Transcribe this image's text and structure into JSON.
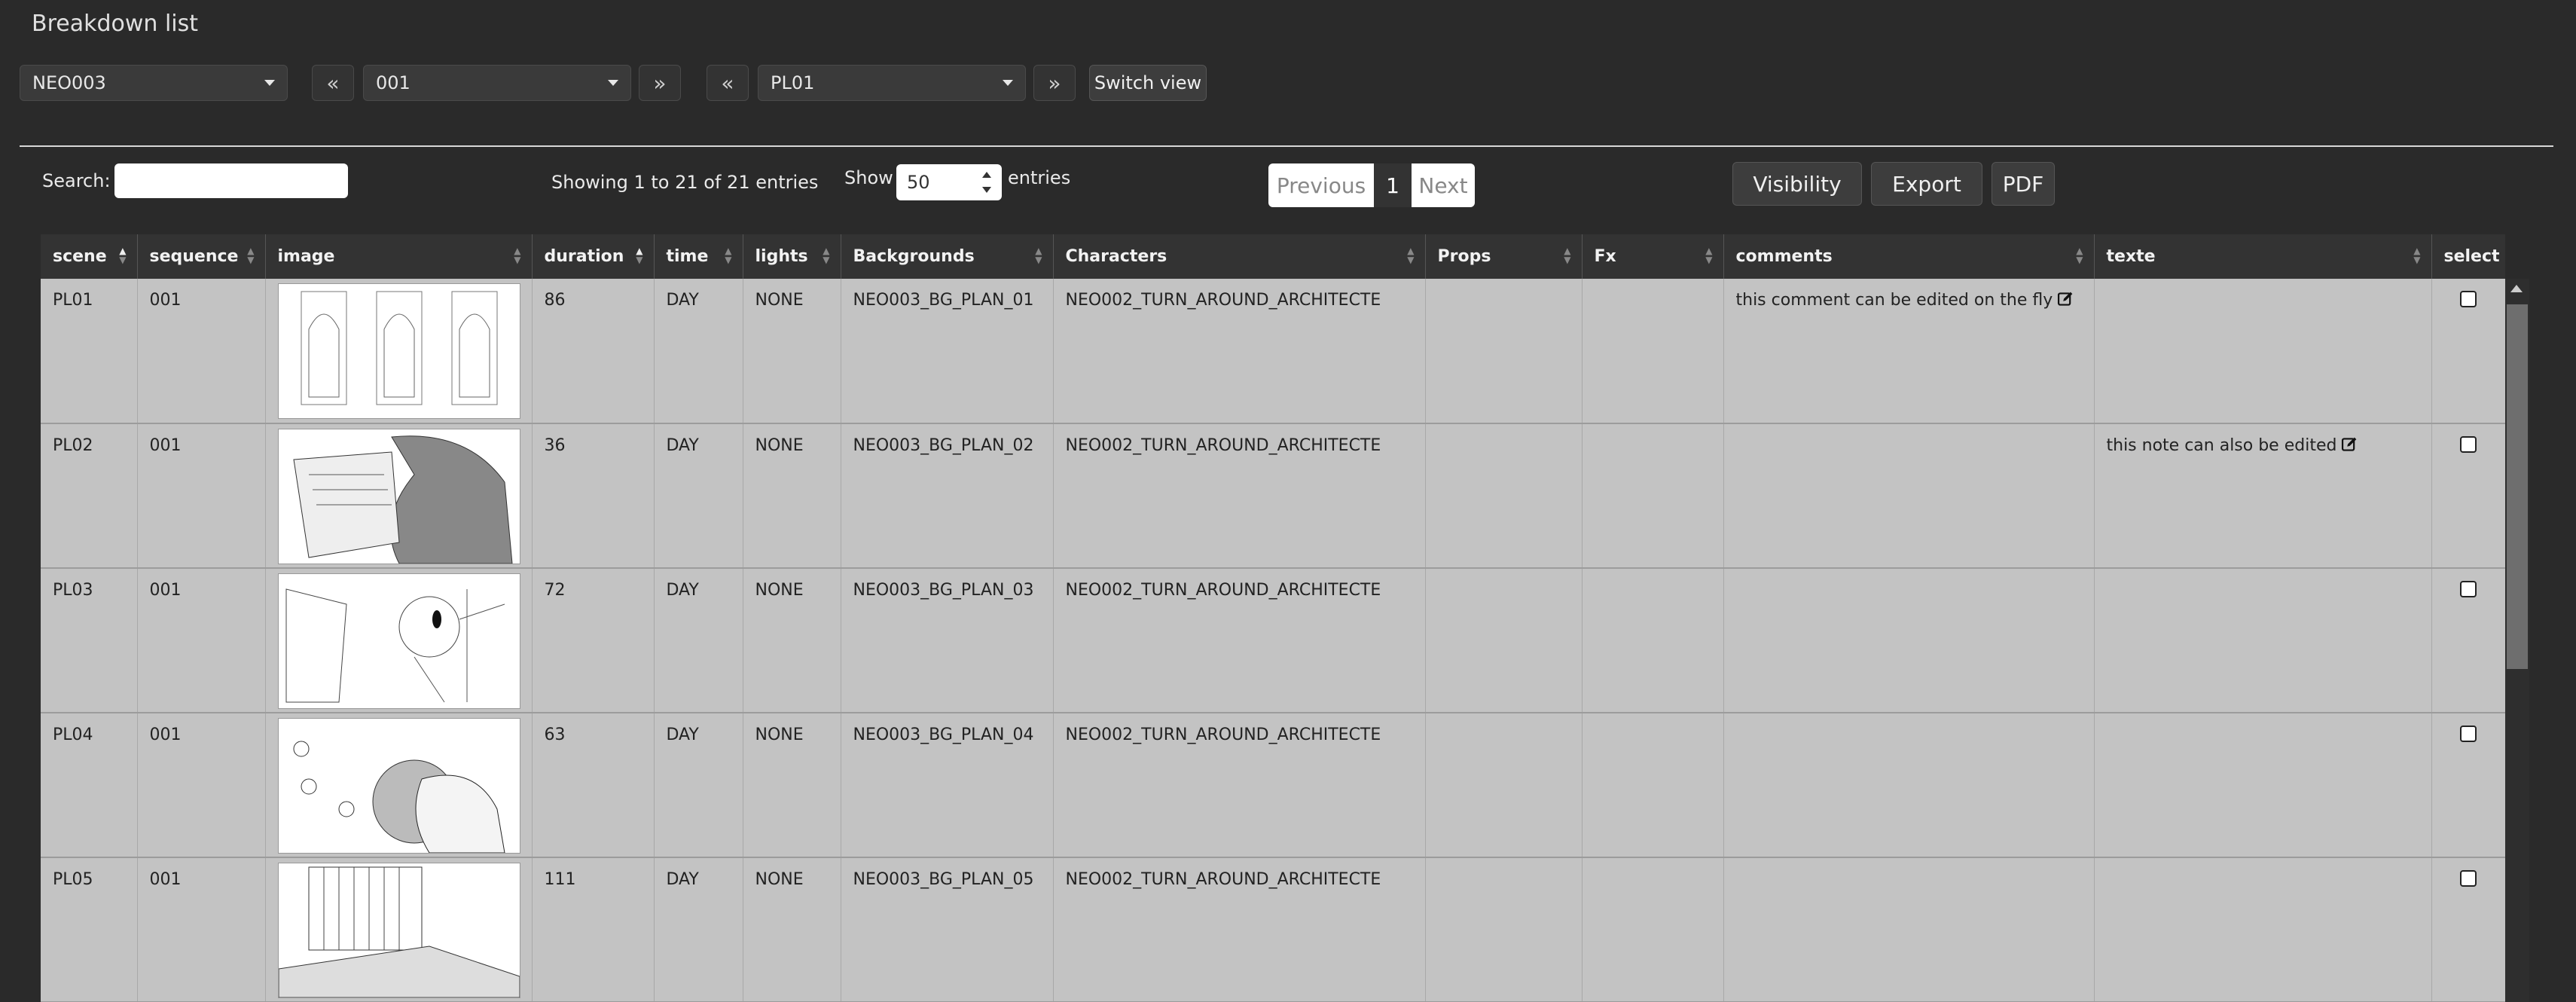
{
  "page_title": "Breakdown list",
  "filters": {
    "project": "NEO003",
    "sequence": "001",
    "plan": "PL01",
    "switch_view": "Switch view",
    "prev_icon": "«",
    "next_icon": "»"
  },
  "controls": {
    "search_label": "Search:",
    "search_value": "",
    "showing_text": "Showing 1 to 21 of 21 entries",
    "show_label": "Show",
    "show_value": "50",
    "entries_label": "entries",
    "pagination": {
      "previous": "Previous",
      "current": "1",
      "next": "Next"
    },
    "visibility": "Visibility",
    "export": "Export",
    "pdf": "PDF"
  },
  "table": {
    "columns": [
      "scene",
      "sequence",
      "image",
      "duration",
      "time",
      "lights",
      "Backgrounds",
      "Characters",
      "Props",
      "Fx",
      "comments",
      "texte",
      "select"
    ],
    "rows": [
      {
        "scene": "PL01",
        "sequence": "001",
        "duration": "86",
        "time": "DAY",
        "lights": "NONE",
        "backgrounds": "NEO003_BG_PLAN_01",
        "characters": "NEO002_TURN_AROUND_ARCHITECTE",
        "props": "",
        "fx": "",
        "comments": "this comment can be edited on the fly",
        "texte": ""
      },
      {
        "scene": "PL02",
        "sequence": "001",
        "duration": "36",
        "time": "DAY",
        "lights": "NONE",
        "backgrounds": "NEO003_BG_PLAN_02",
        "characters": "NEO002_TURN_AROUND_ARCHITECTE",
        "props": "",
        "fx": "",
        "comments": "",
        "texte": "this note can also be edited"
      },
      {
        "scene": "PL03",
        "sequence": "001",
        "duration": "72",
        "time": "DAY",
        "lights": "NONE",
        "backgrounds": "NEO003_BG_PLAN_03",
        "characters": "NEO002_TURN_AROUND_ARCHITECTE",
        "props": "",
        "fx": "",
        "comments": "",
        "texte": ""
      },
      {
        "scene": "PL04",
        "sequence": "001",
        "duration": "63",
        "time": "DAY",
        "lights": "NONE",
        "backgrounds": "NEO003_BG_PLAN_04",
        "characters": "NEO002_TURN_AROUND_ARCHITECTE",
        "props": "",
        "fx": "",
        "comments": "",
        "texte": ""
      },
      {
        "scene": "PL05",
        "sequence": "001",
        "duration": "111",
        "time": "DAY",
        "lights": "NONE",
        "backgrounds": "NEO003_BG_PLAN_05",
        "characters": "NEO002_TURN_AROUND_ARCHITECTE",
        "props": "",
        "fx": "",
        "comments": "",
        "texte": ""
      }
    ]
  }
}
